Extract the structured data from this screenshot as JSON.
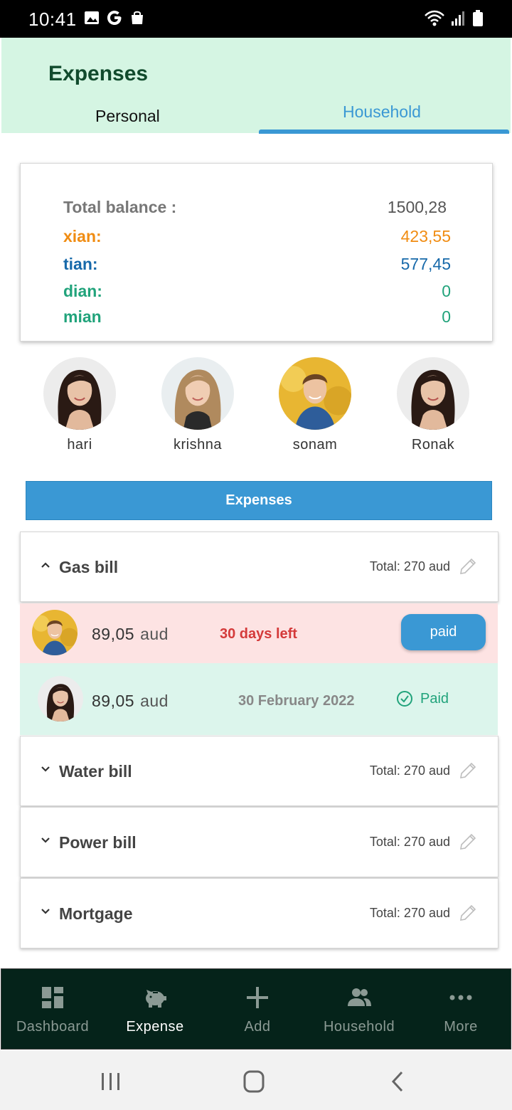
{
  "status_bar": {
    "time": "10:41"
  },
  "header": {
    "title": "Expenses",
    "tabs": [
      {
        "label": "Personal"
      },
      {
        "label": "Household",
        "selected": true
      }
    ]
  },
  "balance": {
    "total_label": "Total balance :",
    "total_value": "1500,28",
    "members": [
      {
        "name": "xian:",
        "value": "423,55",
        "color": "#f08c12"
      },
      {
        "name": "tian:",
        "value": "577,45",
        "color": "#1769aa"
      },
      {
        "name": "dian:",
        "value": "0",
        "color": "#21a37b"
      },
      {
        "name": "mian",
        "value": "0",
        "color": "#21a37b"
      }
    ]
  },
  "members": [
    {
      "name": "hari",
      "avatar": "woman-dark-hair-avatar"
    },
    {
      "name": "krishna",
      "avatar": "woman-blonde-avatar"
    },
    {
      "name": "sonam",
      "avatar": "man-avatar"
    },
    {
      "name": "Ronak",
      "avatar": "woman-dark-hair-avatar"
    }
  ],
  "expenses_header": "Expenses",
  "bills": [
    {
      "name": "Gas bill",
      "total": "Total: 270 aud",
      "expanded": true
    },
    {
      "name": "Water bill",
      "total": "Total: 270 aud",
      "expanded": false
    },
    {
      "name": "Power bill",
      "total": "Total: 270 aud",
      "expanded": false
    },
    {
      "name": "Mortgage",
      "total": "Total: 270 aud",
      "expanded": false
    }
  ],
  "payments": [
    {
      "amount": "89,05",
      "currency": "aud",
      "due": "30 days left",
      "action": "paid",
      "status": "unpaid"
    },
    {
      "amount": "89,05",
      "currency": "aud",
      "date": "30 February 2022",
      "status_label": "Paid",
      "status": "paid"
    }
  ],
  "bottom_nav": [
    {
      "label": "Dashboard",
      "icon": "dashboard-icon"
    },
    {
      "label": "Expense",
      "icon": "piggy-bank-icon",
      "active": true
    },
    {
      "label": "Add",
      "icon": "plus-icon"
    },
    {
      "label": "Household",
      "icon": "people-icon"
    },
    {
      "label": "More",
      "icon": "more-dots-icon"
    }
  ],
  "colors": {
    "accent": "#3a98d4",
    "header_bg": "#d5f5e3",
    "nav_bg": "#05231a",
    "unpaid_bg": "#fde3e3",
    "paid_bg": "#dcf5ec"
  }
}
